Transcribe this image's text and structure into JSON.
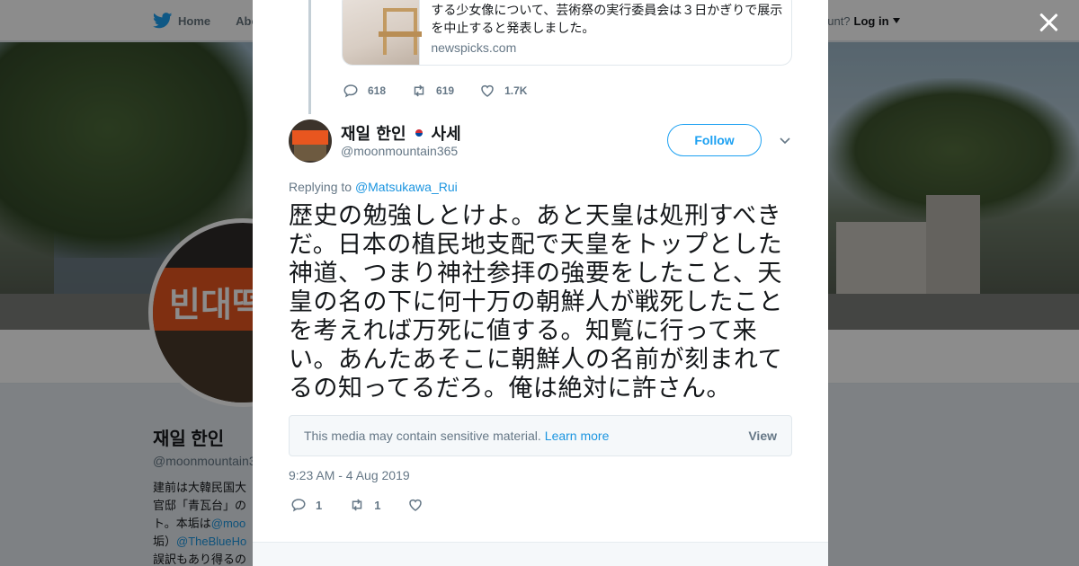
{
  "background": {
    "nav": {
      "home": "Home",
      "about": "Abo"
    },
    "account": {
      "prompt": "ccount?",
      "login": "Log in"
    },
    "profile": {
      "name": "재일 한인",
      "handle": "@moonmountain3",
      "bio_lines": [
        "建前は大韓民国大",
        "官邸「青瓦台」の",
        "ト。本垢は",
        "垢）",
        "誤訳もあり得るの"
      ],
      "bio_links": [
        "@moo",
        "@TheBlueHo"
      ]
    },
    "avatar_sign": "빈대떡"
  },
  "quoted_card": {
    "description": "する少女像について、芸術祭の実行委員会は３日かぎりで展示を中止すると発表しました。",
    "domain": "newspicks.com"
  },
  "parent_actions": {
    "replies": "618",
    "retweets": "619",
    "likes": "1.7K"
  },
  "tweet": {
    "author_name": "재일 한인",
    "author_suffix": "사세",
    "author_handle": "@moonmountain365",
    "follow_label": "Follow",
    "replying_prefix": "Replying to",
    "replying_to": "@Matsukawa_Rui",
    "text": "歴史の勉強しとけよ。あと天皇は処刑すべきだ。日本の植民地支配で天皇をトップとした神道、つまり神社参拝の強要をしたこと、天皇の名の下に何十万の朝鮮人が戦死したことを考えれば万死に値する。知覧に行って来い。あんたあそこに朝鮮人の名前が刻まれてるの知ってるだろ。俺は絶対に許さん。",
    "sensitive_notice": "This media may contain sensitive material.",
    "learn_more": "Learn more",
    "view_label": "View",
    "timestamp": "9:23 AM - 4 Aug 2019",
    "replies": "1",
    "retweets": "1",
    "likes": ""
  },
  "colors": {
    "link": "#1b95e0",
    "accent": "#1da1f2",
    "muted": "#657786"
  },
  "icons": [
    "twitter-bird-icon",
    "close-icon",
    "reply-icon",
    "retweet-icon",
    "heart-icon",
    "chevron-down-icon",
    "korea-flag-icon"
  ]
}
